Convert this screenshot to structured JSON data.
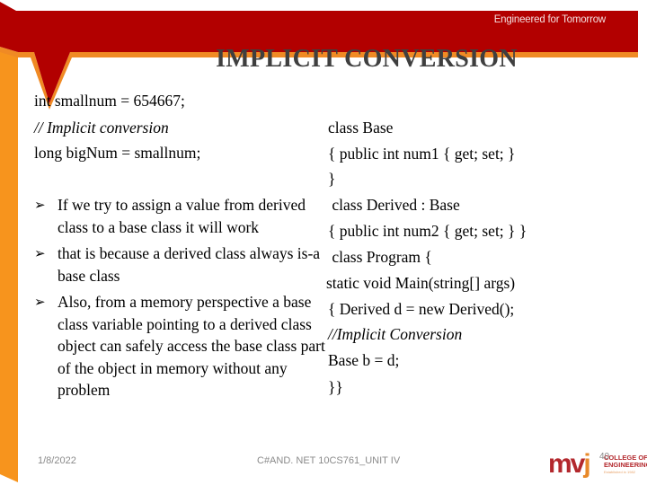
{
  "header": {
    "tagline": "Engineered for Tomorrow",
    "title": "IMPLICIT CONVERSION"
  },
  "colors": {
    "band_red": "#b20000",
    "stripe_orange": "#f7941d",
    "title_gray": "#3f3f3f"
  },
  "left_code": [
    {
      "text": "int smallnum = 654667;",
      "italic": false
    },
    {
      "text": "// Implicit conversion",
      "italic": true
    },
    {
      "text": "long bigNum = smallnum;",
      "italic": false
    }
  ],
  "bullets": [
    {
      "icon": "arrow-bullet-icon",
      "glyph": "➢",
      "text": "If we try to assign a value from derived class to a base class it will work"
    },
    {
      "icon": "arrow-bullet-icon",
      "glyph": "➢",
      "text": "that is because a derived class always is-a base class"
    },
    {
      "icon": "arrow-bullet-icon",
      "glyph": "➢",
      "text": "Also, from a memory perspective a base class variable pointing to a derived class object can safely access the base class part of the object in memory without any problem"
    }
  ],
  "right_code": [
    {
      "text": "class Base",
      "italic": false
    },
    {
      "text": "{ public int num1 { get; set; }",
      "italic": false
    },
    {
      "text": "}",
      "italic": false
    },
    {
      "text": " class Derived : Base",
      "italic": false
    },
    {
      "text": "{ public int num2 { get; set; } }",
      "italic": false
    },
    {
      "text": " class Program {",
      "italic": false
    },
    {
      "text": "static void Main(string[] args)",
      "italic": false
    },
    {
      "text": "{ Derived d = new Derived();",
      "italic": false
    },
    {
      "text": "//Implicit Conversion",
      "italic": true
    },
    {
      "text": "Base b = d;",
      "italic": false
    },
    {
      "text": "}}",
      "italic": false
    }
  ],
  "footer": {
    "date": "1/8/2022",
    "course": "C#AND. NET 10CS761_UNIT IV",
    "slide_number": "40",
    "logo_mark": "mvj",
    "logo_line1": "COLLEGE OF",
    "logo_line2": "ENGINEERING",
    "logo_line3": "Established in 1982"
  }
}
